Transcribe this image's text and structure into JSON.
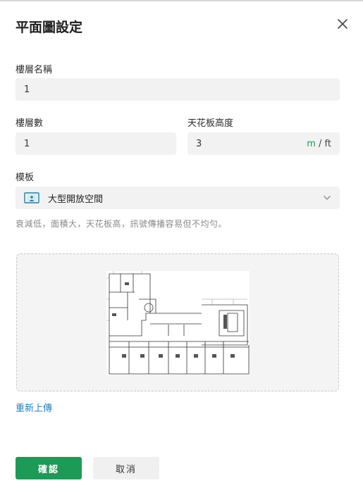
{
  "dialog": {
    "title": "平面圖設定"
  },
  "floor_name": {
    "label": "樓層名稱",
    "value": "1"
  },
  "floor_number": {
    "label": "樓層數",
    "value": "1"
  },
  "ceiling_height": {
    "label": "天花板高度",
    "value": "3",
    "unit_m": "m",
    "unit_sep": " / ",
    "unit_ft": "ft"
  },
  "template": {
    "label": "模板",
    "selected": "大型開放空間",
    "description": "衰減低，面積大，天花板高，訊號傳播容易但不均勻。"
  },
  "upload": {
    "reupload_label": "重新上傳"
  },
  "footer": {
    "confirm_label": "確認",
    "cancel_label": "取消"
  },
  "colors": {
    "accent": "#1e9a57",
    "link": "#1a7fc8"
  },
  "icons": {
    "close": "close-icon",
    "template": "open-space-template-icon",
    "chevron": "chevron-down-icon"
  }
}
